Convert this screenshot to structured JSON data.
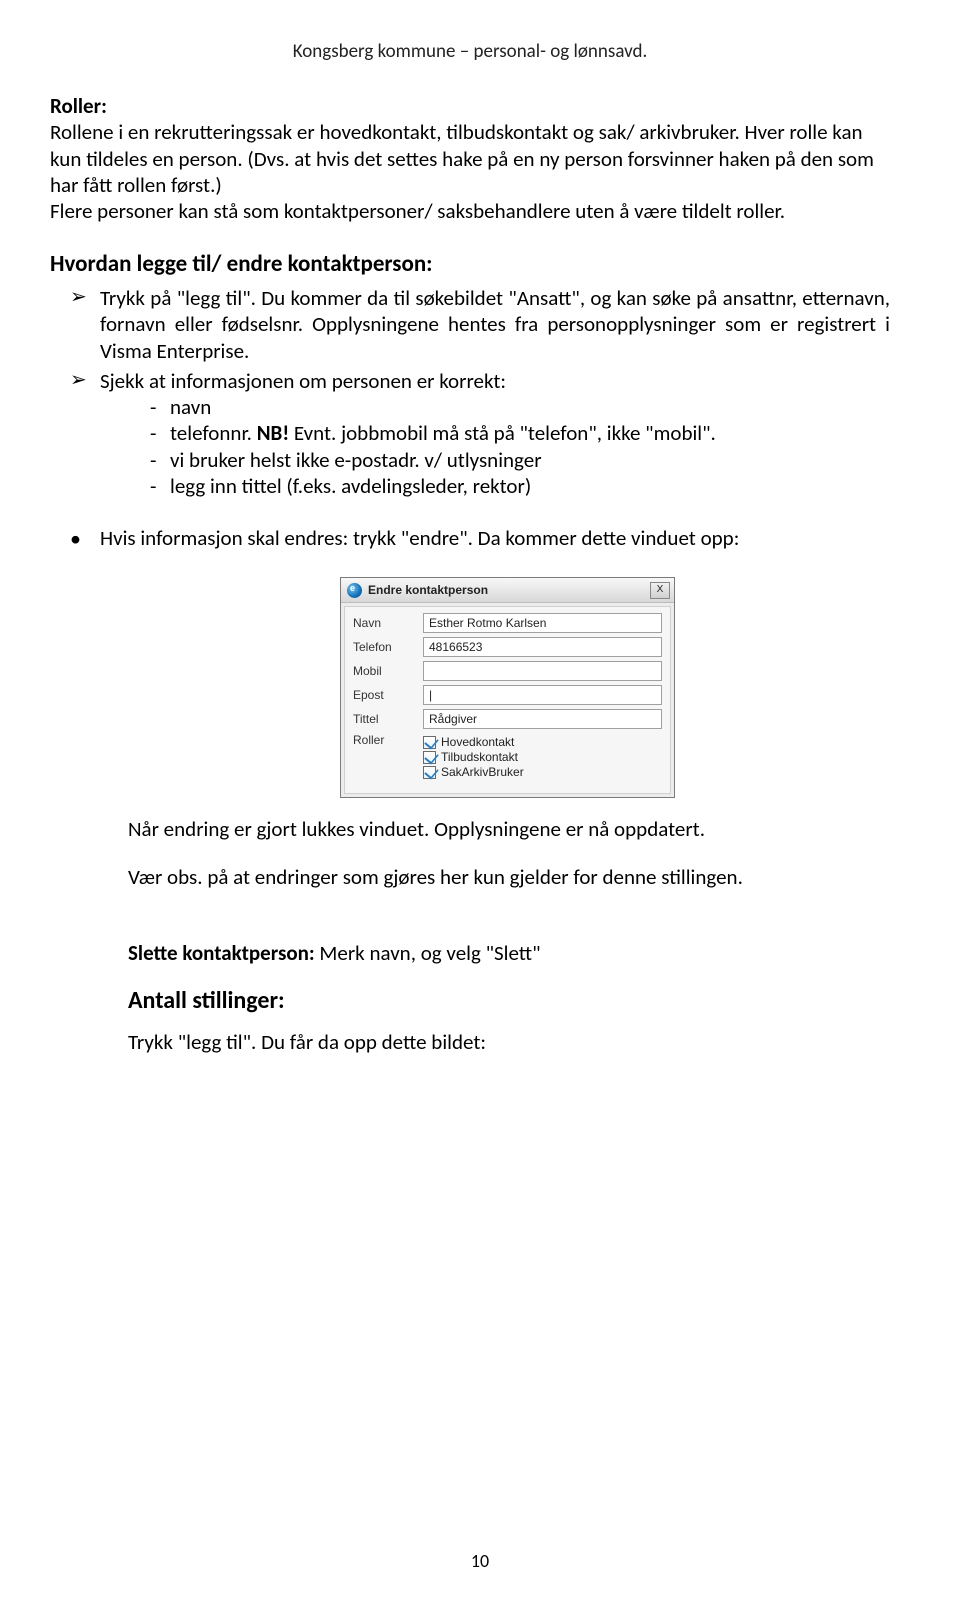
{
  "header": "Kongsberg kommune – personal- og lønnsavd.",
  "section1": {
    "title": "Roller:",
    "p1": "Rollene i en rekrutteringssak er hovedkontakt, tilbudskontakt og sak/ arkivbruker. Hver rolle kan kun tildeles en person. (Dvs. at hvis det settes hake på en ny person forsvinner haken på den som har fått rollen først.)",
    "p2": "Flere personer kan stå som kontaktpersoner/ saksbehandlere uten å være tildelt roller."
  },
  "section2": {
    "title": "Hvordan legge til/ endre kontaktperson:",
    "li1": "Trykk på \"legg til\". Du kommer da til søkebildet \"Ansatt\", og kan søke på ansattnr, etternavn, fornavn eller fødselsnr. Opplysningene hentes fra personopplysninger som er registrert i Visma Enterprise.",
    "li2_intro": "Sjekk at informasjonen om personen er korrekt:",
    "d1": "navn",
    "d2a": "telefonnr. ",
    "d2b": "NB!",
    "d2c": " Evnt. jobbmobil må stå på \"telefon\", ikke \"mobil\".",
    "d3": "vi bruker helst ikke e-postadr. v/ utlysninger",
    "d4": "legg inn tittel (f.eks. avdelingsleder, rektor)",
    "bullet": "Hvis informasjon skal endres: trykk \"endre\". Da kommer dette vinduet opp:"
  },
  "dialog": {
    "title": "Endre kontaktperson",
    "labels": {
      "navn": "Navn",
      "telefon": "Telefon",
      "mobil": "Mobil",
      "epost": "Epost",
      "tittel": "Tittel",
      "roller": "Roller"
    },
    "values": {
      "navn": "Esther Rotmo Karlsen",
      "telefon": "48166523",
      "mobil": "",
      "epost": "|",
      "tittel": "Rådgiver"
    },
    "roles": [
      "Hovedkontakt",
      "Tilbudskontakt",
      "SakArkivBruker"
    ],
    "close": "X"
  },
  "after": {
    "p1": "Når endring er gjort lukkes vinduet. Opplysningene er nå oppdatert.",
    "p2": "Vær obs. på at endringer som gjøres her kun gjelder for denne stillingen.",
    "slette_b": "Slette kontaktperson:",
    "slette_rest": " Merk navn, og velg \"Slett\"",
    "antall_h": "Antall stillinger:",
    "antall_p": "Trykk \"legg til\". Du får da opp dette bildet:"
  },
  "pagenum": "10"
}
